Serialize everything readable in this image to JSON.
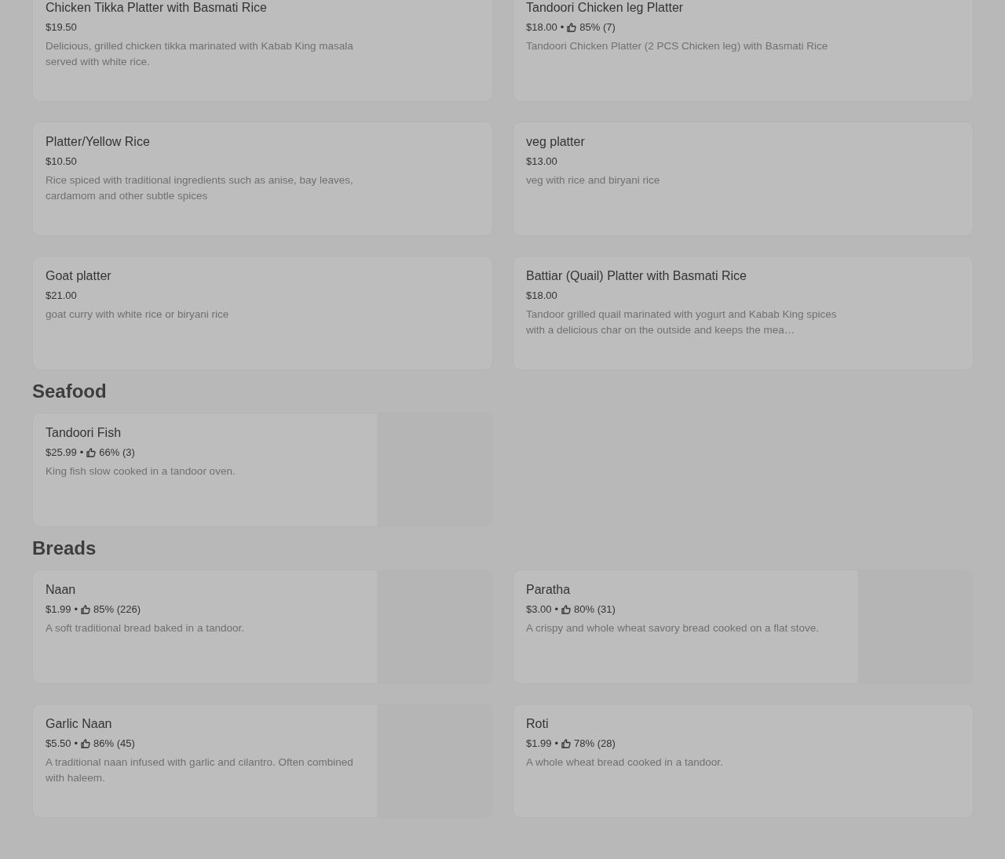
{
  "sections": [
    {
      "items": [
        {
          "name": "Chicken Tikka Platter with Basmati Rice",
          "price": "$19.50",
          "description": "Delicious, grilled chicken tikka marinated with Kabab King masala served with white rice.",
          "has_image": false
        },
        {
          "name": "Tandoori Chicken leg Platter",
          "price": "$18.00",
          "rating": "85% (7)",
          "separator": "•",
          "description": "Tandoori Chicken Platter (2 PCS Chicken leg) with Basmati Rice",
          "has_image": false
        },
        {
          "name": "Platter/Yellow Rice",
          "price": "$10.50",
          "description": "Rice spiced with traditional ingredients such as anise, bay leaves, cardamom and other subtle spices",
          "has_image": false
        },
        {
          "name": "veg platter",
          "price": "$13.00",
          "description": "veg with rice and biryani rice",
          "has_image": false
        },
        {
          "name": "Goat platter",
          "price": "$21.00",
          "description": "goat curry with white rice or biryani rice",
          "has_image": false
        },
        {
          "name": "Battiar (Quail) Platter with Basmati Rice",
          "price": "$18.00",
          "description": "Tandoor grilled quail marinated with yogurt and Kabab King spices with a delicious char on the outside and keeps the mea…",
          "has_image": false
        }
      ]
    },
    {
      "heading": "Seafood",
      "items": [
        {
          "name": "Tandoori Fish",
          "price": "$25.99",
          "rating": "66% (3)",
          "separator": "•",
          "description": "King fish slow cooked in a tandoor oven.",
          "has_image": true
        }
      ]
    },
    {
      "heading": "Breads",
      "items": [
        {
          "name": "Naan",
          "price": "$1.99",
          "rating": "85% (226)",
          "separator": "•",
          "description": "A soft traditional bread baked in a tandoor.",
          "has_image": true
        },
        {
          "name": "Paratha",
          "price": "$3.00",
          "rating": "80% (31)",
          "separator": "•",
          "description": "A crispy and whole wheat savory bread cooked on a flat stove.",
          "has_image": true
        },
        {
          "name": "Garlic Naan",
          "price": "$5.50",
          "rating": "86% (45)",
          "separator": "•",
          "description": "A traditional naan infused with garlic and cilantro. Often combined with haleem.",
          "has_image": true
        },
        {
          "name": "Roti",
          "price": "$1.99",
          "rating": "78% (28)",
          "separator": "•",
          "description": "A whole wheat bread cooked in a tandoor.",
          "has_image": false
        }
      ]
    }
  ]
}
